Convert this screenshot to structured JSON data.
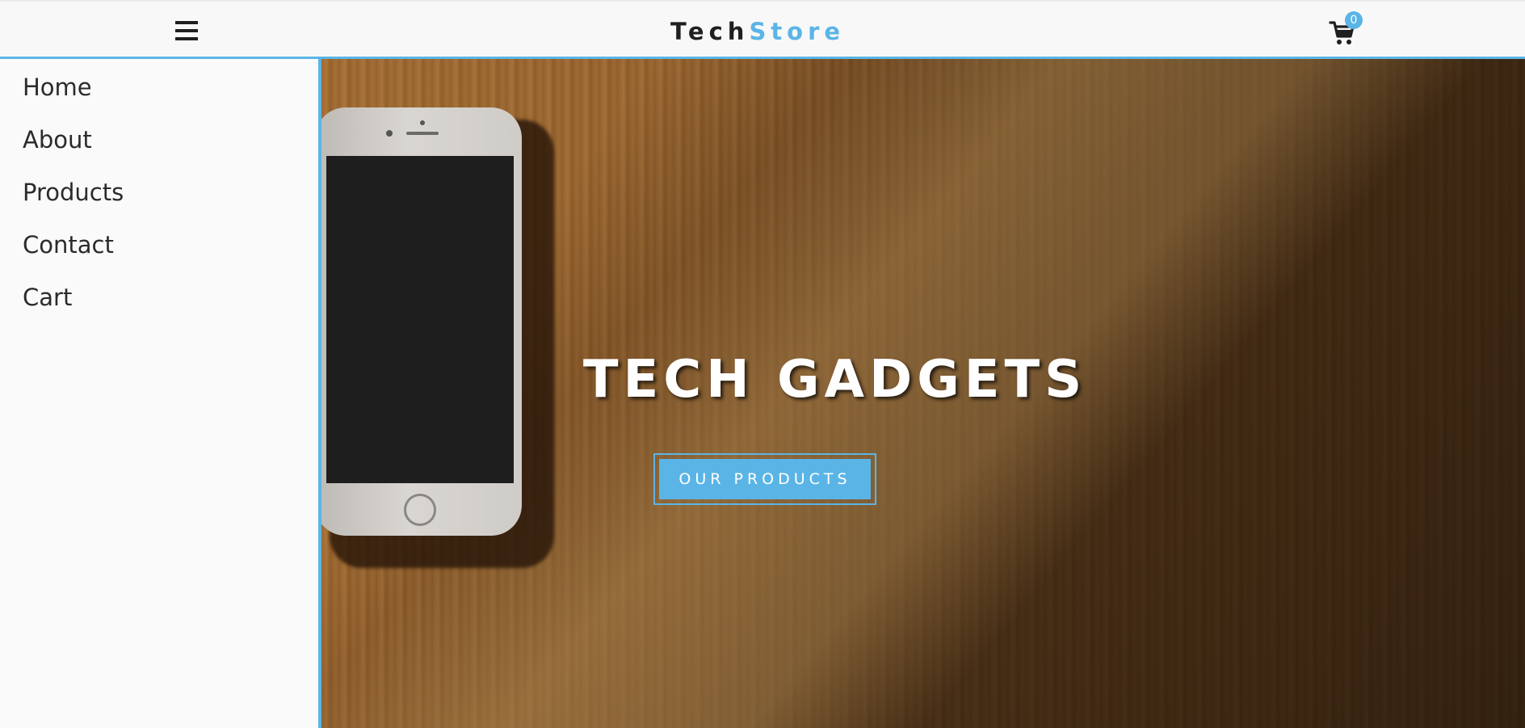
{
  "navbar": {
    "brand_part1": "Tech",
    "brand_part2": "Store",
    "cart_count": "0",
    "menu_icon": "hamburger-menu-icon",
    "cart_icon": "shopping-cart-icon"
  },
  "sidemenu": {
    "items": [
      {
        "label": "Home"
      },
      {
        "label": "About"
      },
      {
        "label": "Products"
      },
      {
        "label": "Contact"
      },
      {
        "label": "Cart"
      }
    ]
  },
  "hero": {
    "title": "TECH GADGETS",
    "button_label": "OUR PRODUCTS"
  },
  "colors": {
    "accent": "#5ab5e6",
    "text_dark": "#1f1f1f",
    "background": "#fafafa"
  }
}
